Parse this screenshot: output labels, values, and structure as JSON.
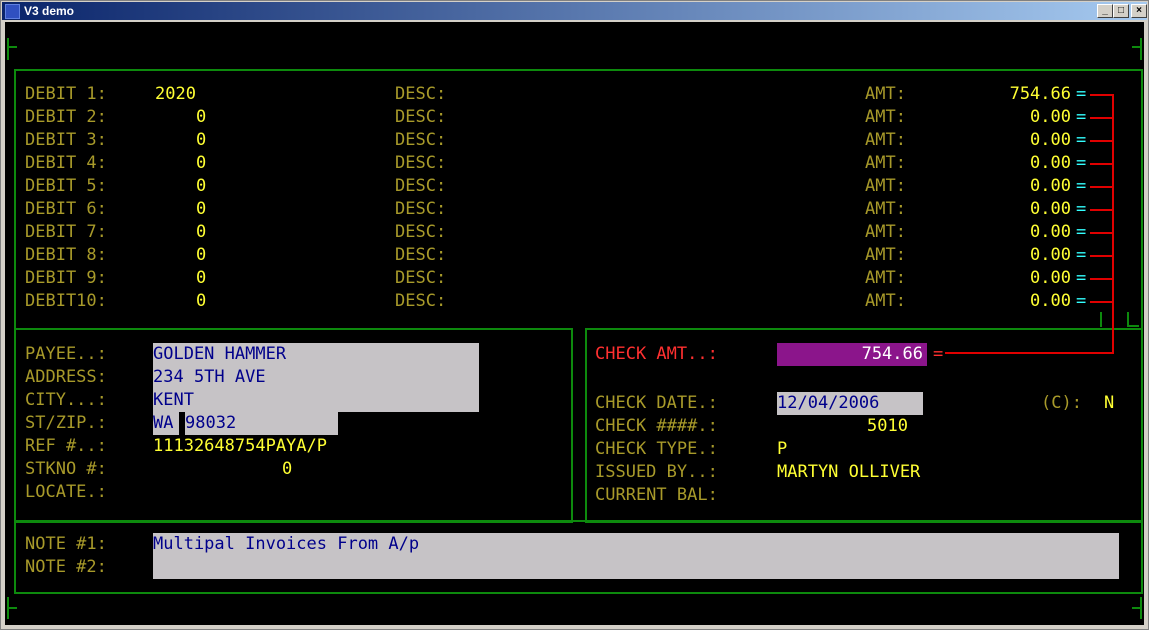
{
  "window": {
    "title": "V3 demo",
    "min": "_",
    "max": "□",
    "close": "×"
  },
  "debits": [
    {
      "label": "DEBIT 1:",
      "value": "2020",
      "desc_label": "DESC:",
      "amt_label": "AMT:",
      "amount": "754.66",
      "eq": "="
    },
    {
      "label": "DEBIT 2:",
      "value": "0",
      "desc_label": "DESC:",
      "amt_label": "AMT:",
      "amount": "0.00",
      "eq": "="
    },
    {
      "label": "DEBIT 3:",
      "value": "0",
      "desc_label": "DESC:",
      "amt_label": "AMT:",
      "amount": "0.00",
      "eq": "="
    },
    {
      "label": "DEBIT 4:",
      "value": "0",
      "desc_label": "DESC:",
      "amt_label": "AMT:",
      "amount": "0.00",
      "eq": "="
    },
    {
      "label": "DEBIT 5:",
      "value": "0",
      "desc_label": "DESC:",
      "amt_label": "AMT:",
      "amount": "0.00",
      "eq": "="
    },
    {
      "label": "DEBIT 6:",
      "value": "0",
      "desc_label": "DESC:",
      "amt_label": "AMT:",
      "amount": "0.00",
      "eq": "="
    },
    {
      "label": "DEBIT 7:",
      "value": "0",
      "desc_label": "DESC:",
      "amt_label": "AMT:",
      "amount": "0.00",
      "eq": "="
    },
    {
      "label": "DEBIT 8:",
      "value": "0",
      "desc_label": "DESC:",
      "amt_label": "AMT:",
      "amount": "0.00",
      "eq": "="
    },
    {
      "label": "DEBIT 9:",
      "value": "0",
      "desc_label": "DESC:",
      "amt_label": "AMT:",
      "amount": "0.00",
      "eq": "="
    },
    {
      "label": "DEBIT10:",
      "value": "0",
      "desc_label": "DESC:",
      "amt_label": "AMT:",
      "amount": "0.00",
      "eq": "="
    }
  ],
  "payee": {
    "payee_label": "PAYEE..:",
    "payee": "GOLDEN HAMMER",
    "address_label": "ADDRESS:",
    "address": "234 5TH AVE",
    "city_label": "CITY...:",
    "city": "KENT",
    "stzip_label": "ST/ZIP.:",
    "state": "WA",
    "zip": "98032",
    "ref_label": "REF #..:",
    "ref": "11132648754PAYA/P",
    "stkno_label": "STKNO #:",
    "stkno": "0",
    "locate_label": "LOCATE.:"
  },
  "check": {
    "amt_label": "CHECK AMT..:",
    "amt": "754.66",
    "eq": "=",
    "date_label": "CHECK DATE.:",
    "date": "12/04/2006",
    "c_label": "(C):",
    "c_value": "N",
    "num_label": "CHECK ####.:",
    "num": "5010",
    "type_label": "CHECK TYPE.:",
    "type": "P",
    "issued_label": "ISSUED BY..:",
    "issued": "MARTYN OLLIVER",
    "bal_label": "CURRENT BAL:"
  },
  "notes": {
    "note1_label": "NOTE #1:",
    "note1": "Multipal Invoices From A/p",
    "note2_label": "NOTE #2:",
    "note2": ""
  }
}
